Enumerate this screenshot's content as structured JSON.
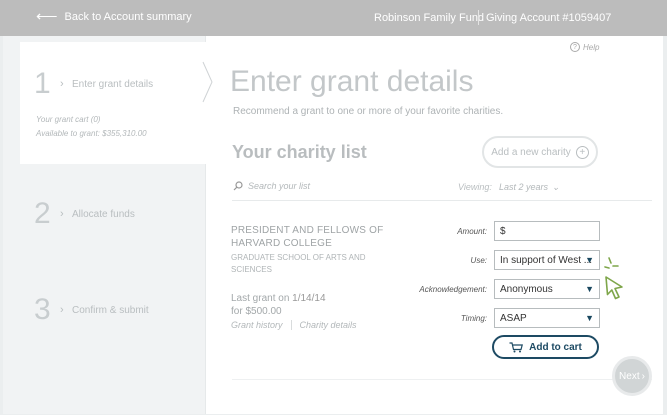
{
  "topbar": {
    "back_label": "Back to Account summary",
    "fund_name": "Robinson Family Fund",
    "account": "Giving Account #1059407"
  },
  "help_label": "Help",
  "steps": [
    {
      "number": "1",
      "label": "Enter grant details",
      "active": true
    },
    {
      "number": "2",
      "label": "Allocate funds",
      "active": false
    },
    {
      "number": "3",
      "label": "Confirm & submit",
      "active": false
    }
  ],
  "cart": {
    "line": "Your grant cart (0)",
    "available": "Available to grant: $355,310.00"
  },
  "main": {
    "title": "Enter grant details",
    "subtitle": "Recommend a grant to one or more of your favorite charities.",
    "list_title": "Your charity list",
    "add_charity_label": "Add a new charity",
    "search_placeholder": "Search your list",
    "viewing_label": "Viewing:",
    "viewing_value": "Last 2 years"
  },
  "charity": {
    "name": "PRESIDENT AND FELLOWS OF HARVARD COLLEGE",
    "department": "GRADUATE SCHOOL OF ARTS AND SCIENCES",
    "last_grant_prefix": "Last grant on",
    "last_grant_date": "1/14/14",
    "last_grant_amount": "for $500.00",
    "grant_history_link": "Grant history",
    "charity_details_link": "Charity details"
  },
  "form": {
    "amount_label": "Amount:",
    "amount_value": "$",
    "use_label": "Use:",
    "use_value": "In support of West ...",
    "ack_label": "Acknowledgement:",
    "ack_value": "Anonymous",
    "timing_label": "Timing:",
    "timing_value": "ASAP",
    "add_to_cart_label": "Add to cart"
  },
  "next_label": "Next",
  "colors": {
    "accent": "#1d4a63",
    "topbar": "#bcbcbc",
    "pointer": "#7ea64a"
  },
  "icons": {
    "back": "left-arrow-icon",
    "help": "question-circle-icon",
    "add": "plus-circle-icon",
    "search": "magnifier-icon",
    "dropdown": "chevron-down-icon",
    "cart": "cart-icon",
    "next": "chevron-right-icon",
    "pointer": "hand-cursor-icon"
  }
}
